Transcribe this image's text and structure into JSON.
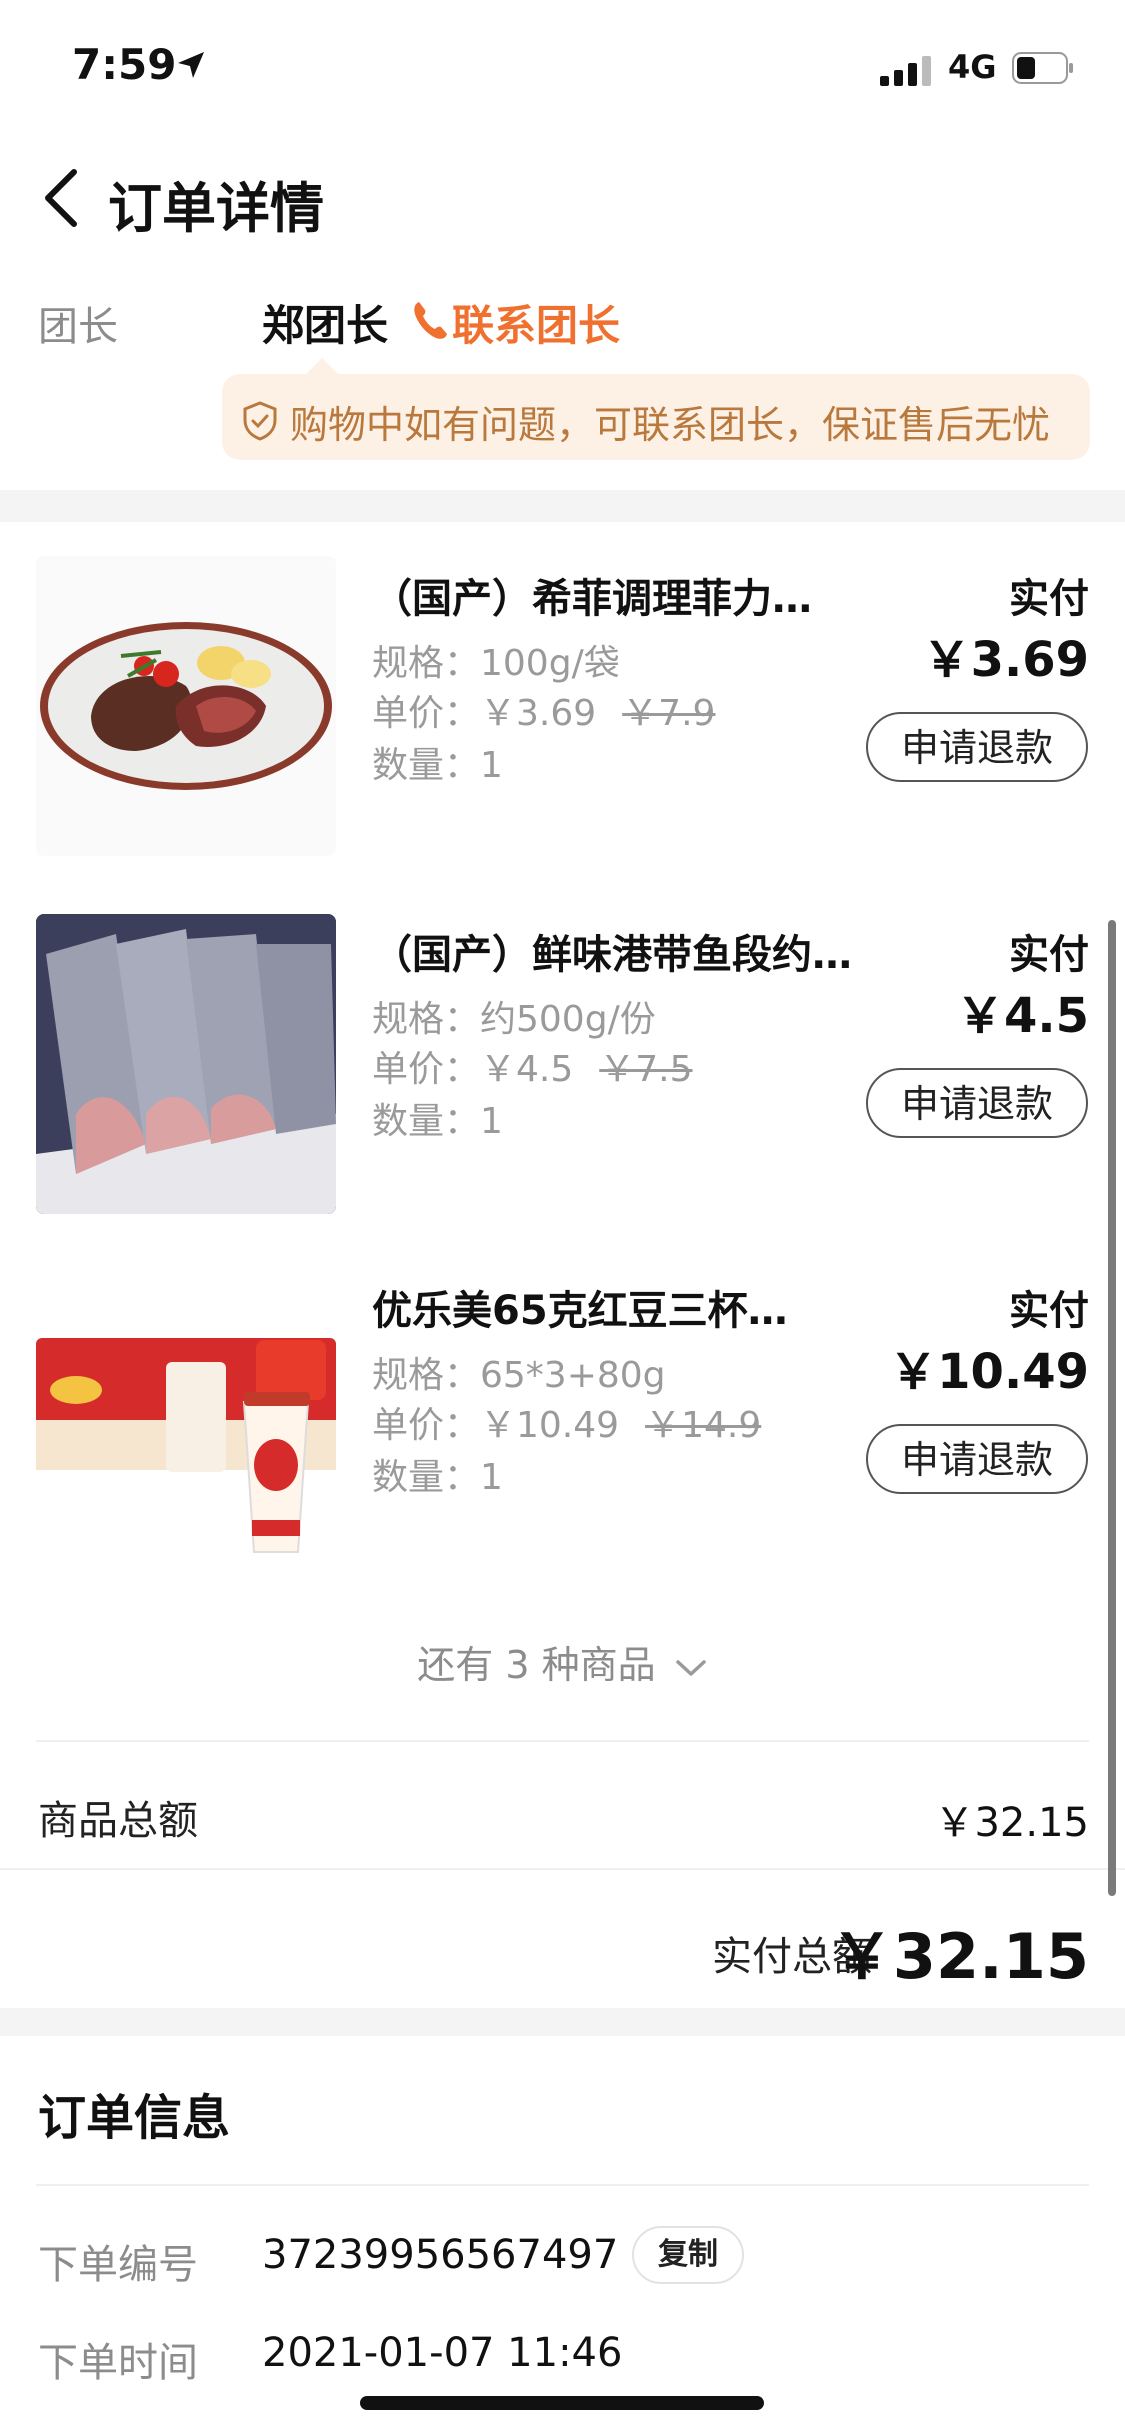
{
  "status_bar": {
    "time": "7:59",
    "network": "4G"
  },
  "header": {
    "title": "订单详情"
  },
  "leader": {
    "label": "团长",
    "name": "郑团长",
    "contact": "联系团长",
    "tip": "购物中如有问题，可联系团长，保证售后无忧"
  },
  "products": [
    {
      "name": "（国产）希菲调理菲力…",
      "spec": "规格：100g/袋",
      "price": "单价：￥3.69",
      "orig_price": "￥7.9",
      "qty": "数量：1",
      "paid_label": "实付",
      "paid": "￥3.69",
      "refund": "申请退款"
    },
    {
      "name": "（国产）鲜味港带鱼段约…",
      "spec": "规格：约500g/份",
      "price": "单价：￥4.5",
      "orig_price": "￥7.5",
      "qty": "数量：1",
      "paid_label": "实付",
      "paid": "￥4.5",
      "refund": "申请退款"
    },
    {
      "name": "优乐美65克红豆三杯…",
      "spec": "规格：65*3+80g",
      "price": "单价：￥10.49",
      "orig_price": "￥14.9",
      "qty": "数量：1",
      "paid_label": "实付",
      "paid": "￥10.49",
      "refund": "申请退款"
    }
  ],
  "more": "还有 3 种商品",
  "summary": {
    "goods_label": "商品总额",
    "goods_total": "￥32.15",
    "paid_label": "实付总额",
    "paid_total": "￥32.15"
  },
  "order_info": {
    "title": "订单信息",
    "number_label": "下单编号",
    "number": "37239956567497",
    "copy": "复制",
    "time_label": "下单时间",
    "time": "2021-01-07 11:46"
  }
}
